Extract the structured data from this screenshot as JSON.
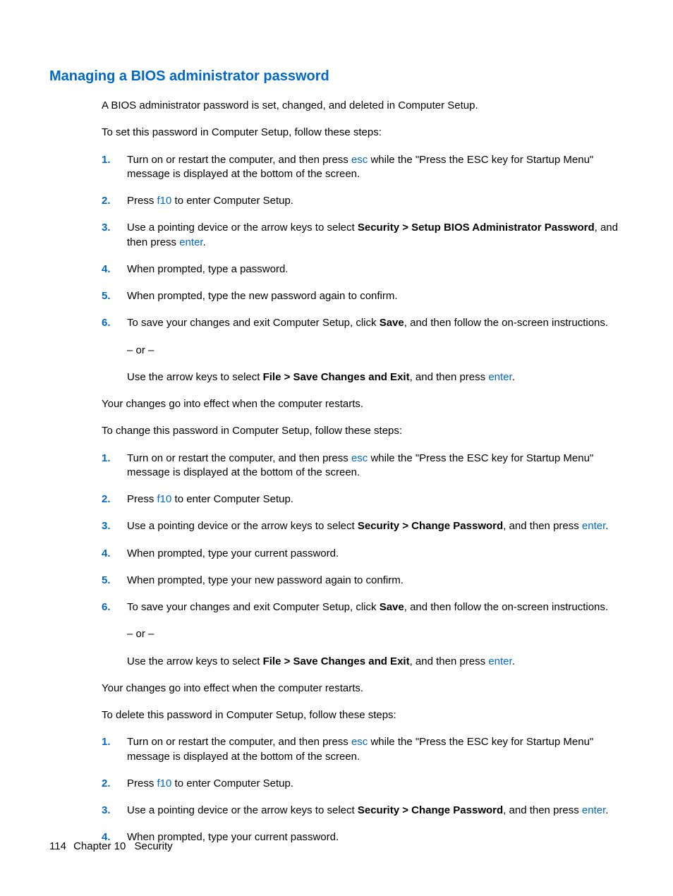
{
  "title": "Managing a BIOS administrator password",
  "intro1": "A BIOS administrator password is set, changed, and deleted in Computer Setup.",
  "intro2": "To set this password in Computer Setup, follow these steps:",
  "set_steps": {
    "s1_a": "Turn on or restart the computer, and then press ",
    "s1_key": "esc",
    "s1_b": " while the \"Press the ESC key for Startup Menu\" message is displayed at the bottom of the screen.",
    "s2_a": "Press ",
    "s2_key": "f10",
    "s2_b": " to enter Computer Setup.",
    "s3_a": "Use a pointing device or the arrow keys to select ",
    "s3_bold": "Security > Setup BIOS Administrator Password",
    "s3_b": ", and then press ",
    "s3_key": "enter",
    "s3_c": ".",
    "s4": "When prompted, type a password.",
    "s5": "When prompted, type the new password again to confirm.",
    "s6_a": "To save your changes and exit Computer Setup, click ",
    "s6_bold": "Save",
    "s6_b": ", and then follow the on-screen instructions.",
    "s6_or": "– or –",
    "s6_c": "Use the arrow keys to select ",
    "s6_bold2": "File > Save Changes and Exit",
    "s6_d": ", and then press ",
    "s6_key": "enter",
    "s6_e": "."
  },
  "after_set": "Your changes go into effect when the computer restarts.",
  "change_intro": "To change this password in Computer Setup, follow these steps:",
  "change_steps": {
    "s1_a": "Turn on or restart the computer, and then press ",
    "s1_key": "esc",
    "s1_b": " while the \"Press the ESC key for Startup Menu\" message is displayed at the bottom of the screen.",
    "s2_a": "Press ",
    "s2_key": "f10",
    "s2_b": " to enter Computer Setup.",
    "s3_a": "Use a pointing device or the arrow keys to select ",
    "s3_bold": "Security > Change Password",
    "s3_b": ", and then press ",
    "s3_key": "enter",
    "s3_c": ".",
    "s4": "When prompted, type your current password.",
    "s5": "When prompted, type your new password again to confirm.",
    "s6_a": "To save your changes and exit Computer Setup, click ",
    "s6_bold": "Save",
    "s6_b": ", and then follow the on-screen instructions.",
    "s6_or": "– or –",
    "s6_c": "Use the arrow keys to select ",
    "s6_bold2": "File > Save Changes and Exit",
    "s6_d": ", and then press ",
    "s6_key": "enter",
    "s6_e": "."
  },
  "after_change": "Your changes go into effect when the computer restarts.",
  "delete_intro": "To delete this password in Computer Setup, follow these steps:",
  "delete_steps": {
    "s1_a": "Turn on or restart the computer, and then press ",
    "s1_key": "esc",
    "s1_b": " while the \"Press the ESC key for Startup Menu\" message is displayed at the bottom of the screen.",
    "s2_a": "Press ",
    "s2_key": "f10",
    "s2_b": " to enter Computer Setup.",
    "s3_a": "Use a pointing device or the arrow keys to select ",
    "s3_bold": "Security > Change Password",
    "s3_b": ", and then press ",
    "s3_key": "enter",
    "s3_c": ".",
    "s4": "When prompted, type your current password."
  },
  "nums": {
    "n1": "1.",
    "n2": "2.",
    "n3": "3.",
    "n4": "4.",
    "n5": "5.",
    "n6": "6."
  },
  "footer": {
    "page": "114",
    "chapter": "Chapter 10",
    "section": "Security"
  }
}
